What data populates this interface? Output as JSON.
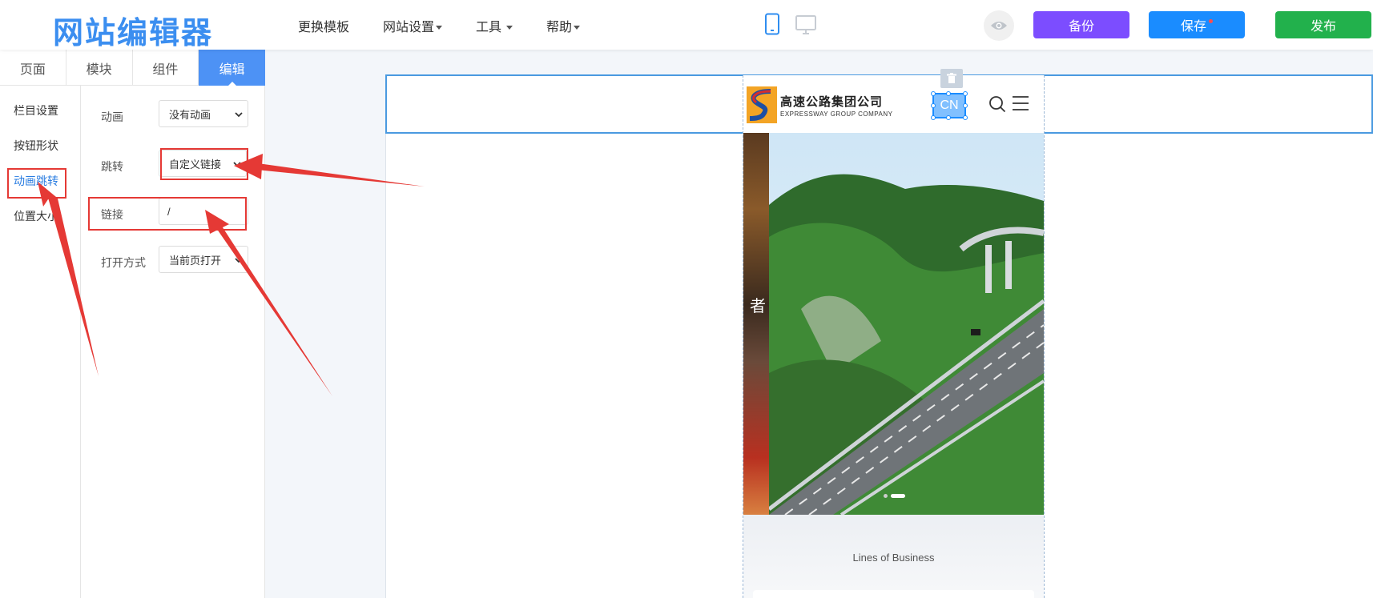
{
  "app": {
    "title": "网站编辑器"
  },
  "nav": {
    "change_template": "更换模板",
    "site_settings": "网站设置",
    "tools": "工具",
    "help": "帮助"
  },
  "toolbar": {
    "backup_label": "备份",
    "save_label": "保存",
    "publish_label": "发布"
  },
  "panel_tabs": [
    "页面",
    "模块",
    "组件",
    "编辑"
  ],
  "side_menu": [
    "栏目设置",
    "按钮形状",
    "动画跳转",
    "位置大小"
  ],
  "form": {
    "animation_label": "动画",
    "animation_value": "没有动画",
    "jump_label": "跳转",
    "jump_value": "自定义链接",
    "link_label": "链接",
    "link_value": "/",
    "open_label": "打开方式",
    "open_value": "当前页打开"
  },
  "preview": {
    "company_cn": "高速公路集团公司",
    "company_en": "EXPRESSWAY GROUP COMPANY",
    "lang_btn": "CN",
    "hero_side_char": "者",
    "section_title": "Lines of Business"
  },
  "colors": {
    "accent": "#4d92f5",
    "backup": "#7c4dff",
    "save": "#1a8cff",
    "publish": "#22b14c",
    "annotation": "#e53935"
  }
}
